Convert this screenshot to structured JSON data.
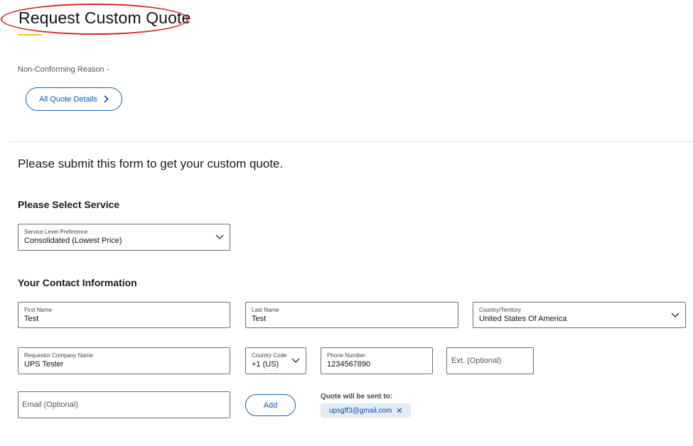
{
  "header": {
    "title": "Request Custom Quote",
    "non_conforming_reason": "Non-Conforming Reason -",
    "all_quote_details_label": "All Quote Details"
  },
  "intro": "Please submit this form to get your custom quote.",
  "service": {
    "heading": "Please Select Service",
    "level_label": "Service Level Preference",
    "level_value": "Consolidated (Lowest Price)"
  },
  "contact": {
    "heading": "Your Contact Information",
    "first_name_label": "First Name",
    "first_name_value": "Test",
    "last_name_label": "Last Name",
    "last_name_value": "Test",
    "country_label": "Country/Territory",
    "country_value": "United States Of America",
    "company_label": "Requestor Company Name",
    "company_value": "UPS Tester",
    "country_code_label": "Country Code",
    "country_code_value": "+1 (US)",
    "phone_label": "Phone Number",
    "phone_value": "1234567890",
    "ext_placeholder": "Ext. (Optional)",
    "email_placeholder": "Email (Optional)",
    "add_label": "Add",
    "quote_sent_label": "Quote will be sent to:",
    "email_chip": "upsgff3@gmail.com",
    "chip_remove": "✕"
  },
  "colors": {
    "accent_blue": "#0b5ab3",
    "highlight_red": "#d02a2a",
    "underline_yellow": "#ffc400"
  }
}
